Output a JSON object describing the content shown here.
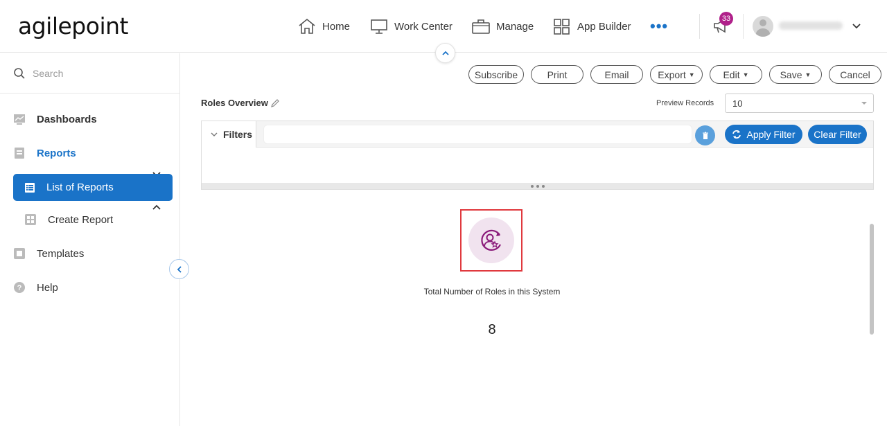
{
  "app": {
    "logo_text": "agilepoint"
  },
  "header": {
    "nav": [
      {
        "label": "Home",
        "icon": "home-icon"
      },
      {
        "label": "Work Center",
        "icon": "monitor-icon"
      },
      {
        "label": "Manage",
        "icon": "briefcase-icon"
      },
      {
        "label": "App Builder",
        "icon": "grid-icon"
      }
    ],
    "more_icon": "more-dots-icon",
    "notification_count": "33",
    "brand_color": "#1a73c8",
    "badge_color": "#b0208a"
  },
  "sidebar": {
    "search_placeholder": "Search",
    "items": [
      {
        "label": "Dashboards"
      },
      {
        "label": "Reports"
      },
      {
        "label": "List of Reports"
      },
      {
        "label": "Create Report"
      },
      {
        "label": "Templates"
      },
      {
        "label": "Help"
      }
    ]
  },
  "toolbar": {
    "subscribe": "Subscribe",
    "print": "Print",
    "email": "Email",
    "export": "Export",
    "edit": "Edit",
    "save": "Save",
    "cancel": "Cancel"
  },
  "report": {
    "title": "Roles Overview",
    "preview_label": "Preview Records",
    "preview_value": "10"
  },
  "filters": {
    "tab_label": "Filters",
    "apply": "Apply Filter",
    "clear": "Clear Filter"
  },
  "kpi": {
    "label": "Total Number of Roles in this System",
    "value": "8",
    "highlight_color": "#e0393e",
    "icon_color": "#8a1a7a"
  }
}
